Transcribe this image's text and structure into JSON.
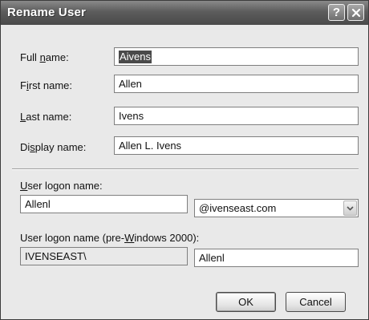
{
  "window": {
    "title": "Rename User"
  },
  "form": {
    "full_name": {
      "label_pre": "Full ",
      "label_key": "n",
      "label_post": "ame:",
      "value": "Aivens"
    },
    "first_name": {
      "label_pre": "F",
      "label_key": "i",
      "label_post": "rst name:",
      "value": "Allen"
    },
    "last_name": {
      "label_pre": "",
      "label_key": "L",
      "label_post": "ast name:",
      "value": "Ivens"
    },
    "display_name": {
      "label_pre": "Di",
      "label_key": "s",
      "label_post": "play name:",
      "value": "Allen L. Ivens"
    }
  },
  "logon": {
    "label_pre": "",
    "label_key": "U",
    "label_post": "ser logon name:",
    "value": "Allenl",
    "domain": "@ivenseast.com"
  },
  "pre2000": {
    "label_pre": "User logon name (pre-",
    "label_key": "W",
    "label_post": "indows 2000):",
    "domain_prefix": "IVENSEAST\\",
    "value": "Allenl"
  },
  "buttons": {
    "ok": "OK",
    "cancel": "Cancel"
  },
  "icons": {
    "help": "help-icon",
    "close": "close-icon",
    "dropdown": "chevron-down-icon"
  }
}
